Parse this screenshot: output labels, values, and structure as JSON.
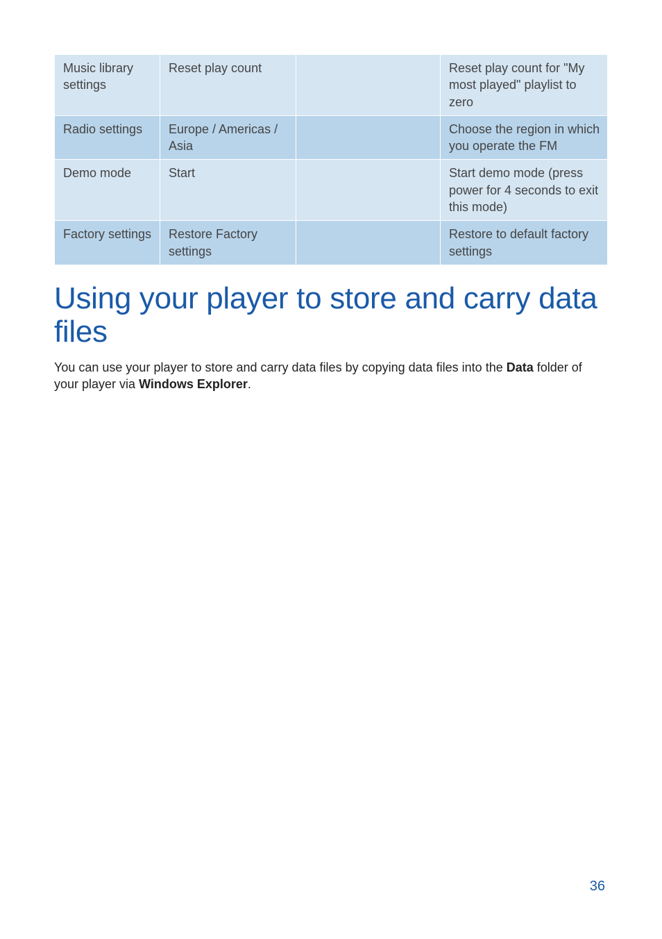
{
  "table": {
    "rows": [
      {
        "c1": "Music library settings",
        "c2": "Reset play count",
        "c3": "",
        "c4": "Reset play count for \"My most played\" playlist to zero"
      },
      {
        "c1": "Radio settings",
        "c2": "Europe / Americas / Asia",
        "c3": "",
        "c4": "Choose the region in which you operate the FM"
      },
      {
        "c1": "Demo mode",
        "c2": "Start",
        "c3": "",
        "c4": "Start demo mode (press power for 4 seconds to exit this mode)"
      },
      {
        "c1": "Factory settings",
        "c2": "Restore Factory settings",
        "c3": "",
        "c4": "Restore to default factory settings"
      }
    ]
  },
  "heading": "Using your player to store and carry data files",
  "paragraph": {
    "pre": "You can use your player to store and carry data files by copying data files into the ",
    "bold1": "Data",
    "mid": " folder of your player via ",
    "bold2": "Windows Explorer",
    "post": "."
  },
  "pageNumber": "36"
}
